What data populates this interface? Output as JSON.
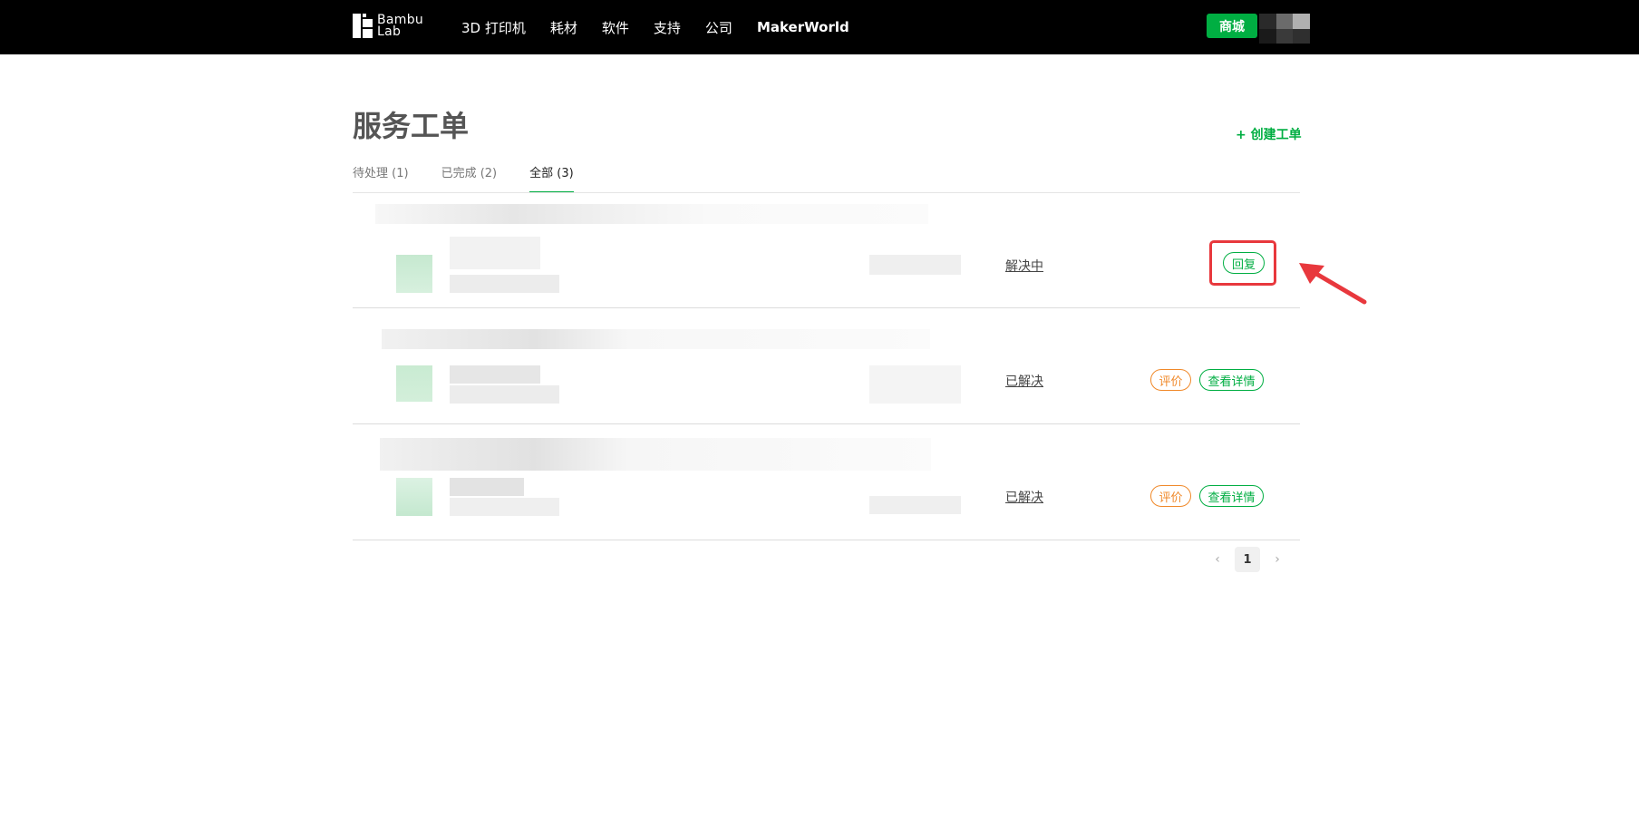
{
  "nav": {
    "logo_line1": "Bambu",
    "logo_line2": "Lab",
    "items": [
      "3D 打印机",
      "耗材",
      "软件",
      "支持",
      "公司",
      "MakerWorld"
    ],
    "shop": "商城"
  },
  "page": {
    "title": "服务工单",
    "create": "+ 创建工单"
  },
  "tabs": [
    {
      "label": "待处理 (1)"
    },
    {
      "label": "已完成 (2)"
    },
    {
      "label": "全部 (3)",
      "active": true
    }
  ],
  "tickets": [
    {
      "status": "解决中",
      "actions": [
        "回复"
      ]
    },
    {
      "status": "已解决",
      "actions": [
        "评价",
        "查看详情"
      ]
    },
    {
      "status": "已解决",
      "actions": [
        "评价",
        "查看详情"
      ]
    }
  ],
  "pagination": {
    "prev": "‹",
    "current": "1",
    "next": "›"
  },
  "colors": {
    "accent": "#00ae42",
    "warning": "#f0892a",
    "highlight": "#e8383d"
  }
}
